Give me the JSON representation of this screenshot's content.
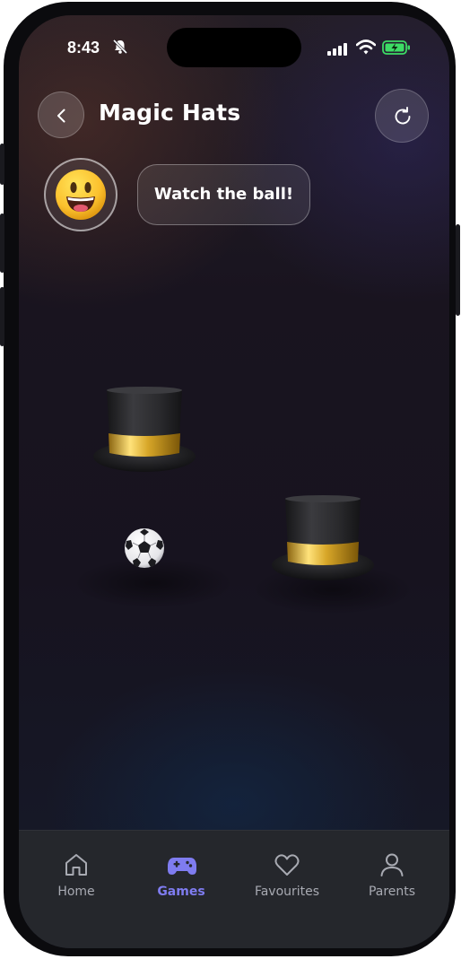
{
  "status_bar": {
    "time": "8:43"
  },
  "header": {
    "title": "Magic Hats"
  },
  "speech": {
    "text": "Watch the ball!"
  },
  "game": {
    "hats_visible": 2,
    "ball_visible": true
  },
  "tab_bar": {
    "items": [
      {
        "label": "Home",
        "icon": "home-icon",
        "active": false
      },
      {
        "label": "Games",
        "icon": "gamepad-icon",
        "active": true
      },
      {
        "label": "Favourites",
        "icon": "heart-icon",
        "active": false
      },
      {
        "label": "Parents",
        "icon": "person-icon",
        "active": false
      }
    ]
  },
  "colors": {
    "accent": "#7f7cf0",
    "tab_bar_bg": "#25272c",
    "battery": "#3ddc65"
  }
}
